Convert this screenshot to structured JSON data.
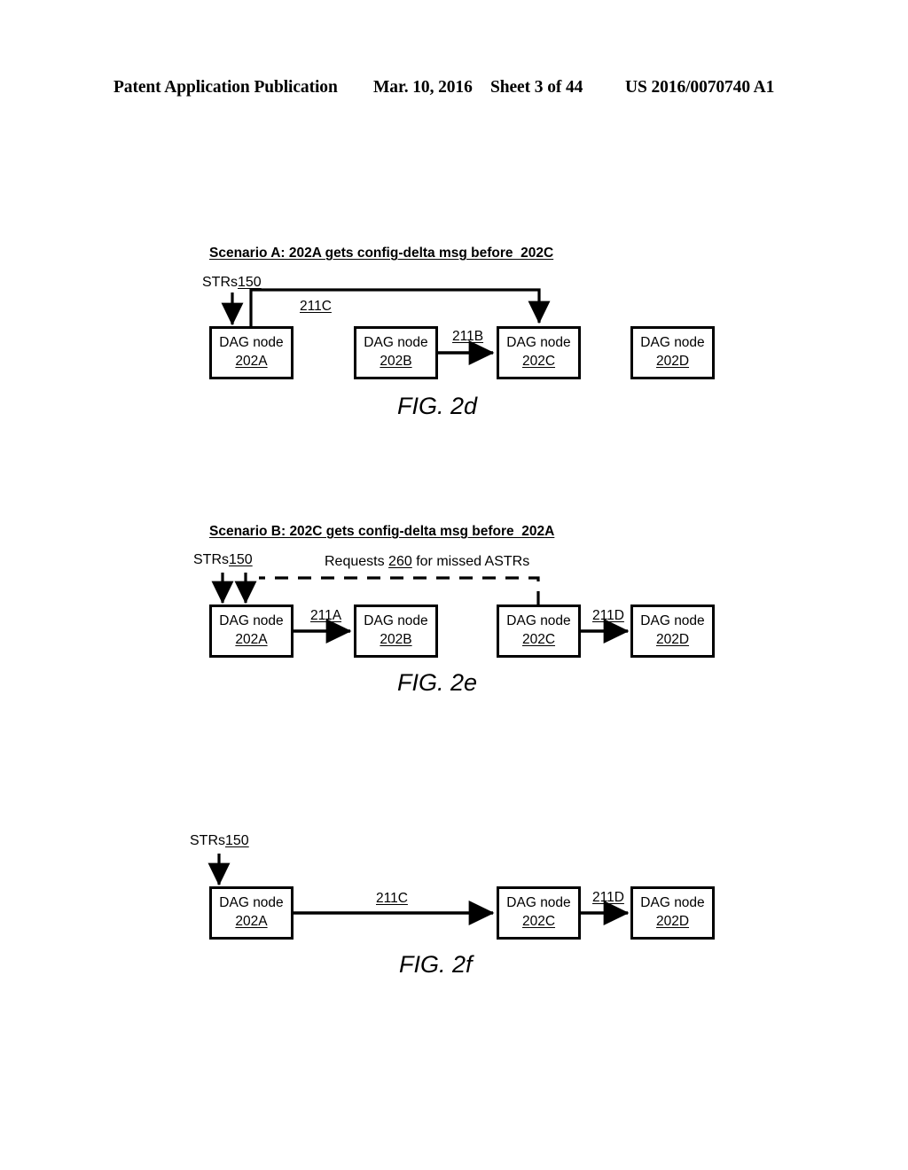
{
  "header": {
    "publication": "Patent Application Publication",
    "date": "Mar. 10, 2016",
    "sheet": "Sheet 3 of 44",
    "patent_number": "US 2016/0070740 A1"
  },
  "figures": [
    {
      "id": "fig-2d",
      "caption": "FIG. 2d",
      "scenario_title": "Scenario A: 202A gets config-delta msg before  202C",
      "input_label": {
        "text": "STRs",
        "ref": "150"
      },
      "nodes": [
        {
          "title": "DAG node",
          "ref": "202A"
        },
        {
          "title": "DAG node",
          "ref": "202B"
        },
        {
          "title": "DAG node",
          "ref": "202C"
        },
        {
          "title": "DAG node",
          "ref": "202D"
        }
      ],
      "edges": [
        {
          "label": "211C",
          "style": "solid",
          "from": "202A",
          "to": "202C"
        },
        {
          "label": "211B",
          "style": "solid",
          "from": "202B",
          "to": "202C"
        }
      ]
    },
    {
      "id": "fig-2e",
      "caption": "FIG. 2e",
      "scenario_title": "Scenario B: 202C gets config-delta msg before  202A",
      "input_label": {
        "text": "STRs",
        "ref": "150"
      },
      "dashed_edge_label": {
        "prefix": "Requests ",
        "ref": "260",
        "suffix": " for missed ASTRs"
      },
      "nodes": [
        {
          "title": "DAG node",
          "ref": "202A"
        },
        {
          "title": "DAG node",
          "ref": "202B"
        },
        {
          "title": "DAG node",
          "ref": "202C"
        },
        {
          "title": "DAG node",
          "ref": "202D"
        }
      ],
      "edges": [
        {
          "label": "211A",
          "style": "solid",
          "from": "202A",
          "to": "202B"
        },
        {
          "label": "211D",
          "style": "solid",
          "from": "202C",
          "to": "202D"
        },
        {
          "label": "Requests 260 for missed ASTRs",
          "style": "dashed",
          "from": "202C",
          "to": "202A"
        }
      ]
    },
    {
      "id": "fig-2f",
      "caption": "FIG. 2f",
      "scenario_title": "",
      "input_label": {
        "text": "STRs",
        "ref": "150"
      },
      "nodes": [
        {
          "title": "DAG node",
          "ref": "202A"
        },
        {
          "title": "DAG node",
          "ref": "202C"
        },
        {
          "title": "DAG node",
          "ref": "202D"
        }
      ],
      "edges": [
        {
          "label": "211C",
          "style": "solid",
          "from": "202A",
          "to": "202C"
        },
        {
          "label": "211D",
          "style": "solid",
          "from": "202C",
          "to": "202D"
        }
      ]
    }
  ]
}
